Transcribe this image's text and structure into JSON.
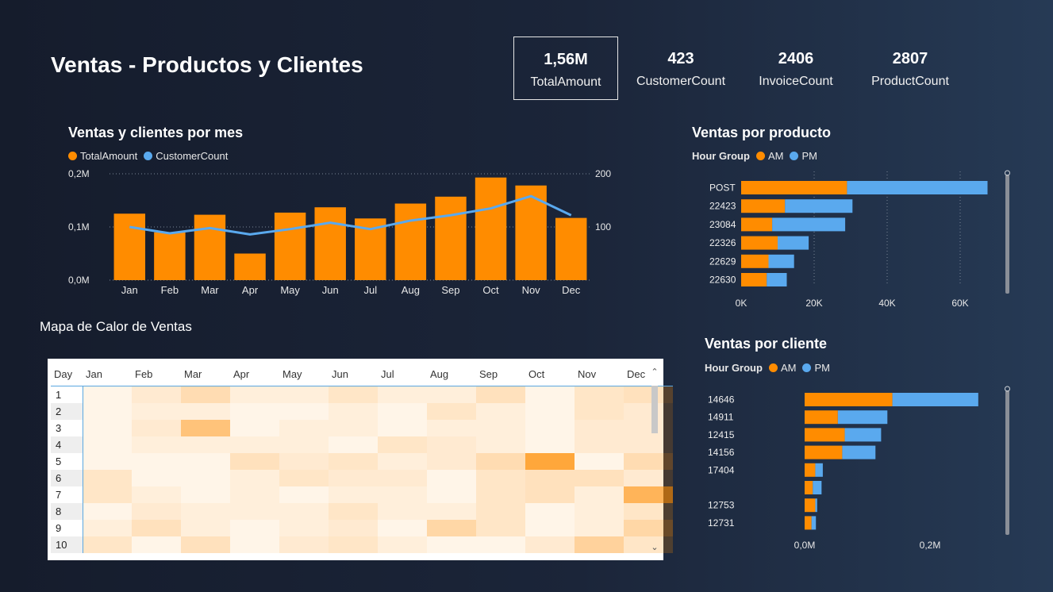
{
  "header": {
    "title": "Ventas - Productos y Clientes"
  },
  "kpis": [
    {
      "value": "1,56M",
      "label": "TotalAmount",
      "selected": true
    },
    {
      "value": "423",
      "label": "CustomerCount"
    },
    {
      "value": "2406",
      "label": "InvoiceCount"
    },
    {
      "value": "2807",
      "label": "ProductCount"
    }
  ],
  "colors": {
    "orange": "#ff8c00",
    "blue": "#5aa9ee"
  },
  "monthly_chart": {
    "title": "Ventas y clientes por mes",
    "legend": [
      "TotalAmount",
      "CustomerCount"
    ]
  },
  "product_chart": {
    "title": "Ventas por producto",
    "legend_title": "Hour Group",
    "legend": [
      "AM",
      "PM"
    ]
  },
  "customer_chart": {
    "title": "Ventas por cliente",
    "legend_title": "Hour Group",
    "legend": [
      "AM",
      "PM"
    ]
  },
  "heatmap": {
    "title": "Mapa de Calor de Ventas",
    "columns": [
      "Day",
      "Jan",
      "Feb",
      "Mar",
      "Apr",
      "May",
      "Jun",
      "Jul",
      "Aug",
      "Sep",
      "Oct",
      "Nov",
      "Dec"
    ],
    "rows": [
      {
        "day": "1",
        "v": [
          0.05,
          0.15,
          0.3,
          0.1,
          0.1,
          0.2,
          0.1,
          0.1,
          0.25,
          0.05,
          0.2,
          0.25
        ]
      },
      {
        "day": "2",
        "v": [
          0.05,
          0.1,
          0.1,
          0.05,
          0.05,
          0.1,
          0.05,
          0.2,
          0.1,
          0.05,
          0.2,
          0.15
        ]
      },
      {
        "day": "3",
        "v": [
          0.05,
          0.15,
          0.55,
          0.05,
          0.1,
          0.1,
          0.05,
          0.1,
          0.1,
          0.05,
          0.15,
          0.15
        ]
      },
      {
        "day": "4",
        "v": [
          0.05,
          0.1,
          0.1,
          0.1,
          0.1,
          0.05,
          0.2,
          0.15,
          0.1,
          0.05,
          0.15,
          0.15
        ]
      },
      {
        "day": "5",
        "v": [
          0.05,
          0.05,
          0.05,
          0.25,
          0.15,
          0.2,
          0.1,
          0.15,
          0.3,
          0.85,
          0.05,
          0.3
        ]
      },
      {
        "day": "6",
        "v": [
          0.2,
          0.05,
          0.05,
          0.1,
          0.2,
          0.15,
          0.15,
          0.05,
          0.2,
          0.25,
          0.25,
          0.15
        ]
      },
      {
        "day": "7",
        "v": [
          0.2,
          0.1,
          0.05,
          0.1,
          0.05,
          0.1,
          0.1,
          0.05,
          0.2,
          0.25,
          0.1,
          0.7
        ]
      },
      {
        "day": "8",
        "v": [
          0.05,
          0.15,
          0.1,
          0.1,
          0.1,
          0.2,
          0.1,
          0.1,
          0.2,
          0.05,
          0.1,
          0.2
        ]
      },
      {
        "day": "9",
        "v": [
          0.1,
          0.25,
          0.1,
          0.05,
          0.1,
          0.15,
          0.05,
          0.35,
          0.2,
          0.05,
          0.1,
          0.35
        ]
      },
      {
        "day": "10",
        "v": [
          0.2,
          0.05,
          0.25,
          0.05,
          0.15,
          0.2,
          0.1,
          0.05,
          0.05,
          0.15,
          0.4,
          0.2
        ]
      }
    ]
  },
  "chart_data": [
    {
      "type": "bar",
      "title": "Ventas y clientes por mes",
      "categories": [
        "Jan",
        "Feb",
        "Mar",
        "Apr",
        "May",
        "Jun",
        "Jul",
        "Aug",
        "Sep",
        "Oct",
        "Nov",
        "Dec"
      ],
      "series": [
        {
          "name": "TotalAmount",
          "type": "bar",
          "axis": "left",
          "values": [
            0.125,
            0.09,
            0.123,
            0.05,
            0.127,
            0.137,
            0.116,
            0.144,
            0.157,
            0.193,
            0.178,
            0.117
          ]
        },
        {
          "name": "CustomerCount",
          "type": "line",
          "axis": "right",
          "values": [
            100,
            88,
            98,
            86,
            96,
            108,
            96,
            112,
            122,
            135,
            158,
            122
          ]
        }
      ],
      "y_left": {
        "ticks": [
          "0,0M",
          "0,1M",
          "0,2M"
        ],
        "range": [
          0,
          0.2
        ],
        "unit": "M"
      },
      "y_right": {
        "ticks": [
          "100",
          "200"
        ],
        "range": [
          0,
          200
        ]
      },
      "grid": true
    },
    {
      "type": "bar",
      "orientation": "horizontal",
      "stacked": true,
      "title": "Ventas por producto",
      "categories": [
        "POST",
        "22423",
        "23084",
        "22326",
        "22629",
        "22630"
      ],
      "series": [
        {
          "name": "AM",
          "values": [
            29000,
            12000,
            8500,
            10000,
            7500,
            7000
          ]
        },
        {
          "name": "PM",
          "values": [
            38500,
            18500,
            20000,
            8500,
            7000,
            5500
          ]
        }
      ],
      "x_ticks": [
        "0K",
        "20K",
        "40K",
        "60K"
      ],
      "x_range": [
        0,
        70000
      ],
      "grid": true
    },
    {
      "type": "bar",
      "orientation": "horizontal",
      "stacked": true,
      "title": "Ventas por cliente",
      "categories": [
        "14646",
        "14911",
        "12415",
        "14156",
        "17404",
        "",
        "12753",
        "12731"
      ],
      "series": [
        {
          "name": "AM",
          "values": [
            0.14,
            0.053,
            0.064,
            0.06,
            0.017,
            0.013,
            0.017,
            0.011
          ]
        },
        {
          "name": "PM",
          "values": [
            0.137,
            0.079,
            0.058,
            0.053,
            0.012,
            0.014,
            0.003,
            0.007
          ]
        }
      ],
      "x_ticks": [
        "0,0M",
        "0,2M"
      ],
      "x_range": [
        0,
        0.3
      ],
      "unit": "M"
    }
  ]
}
